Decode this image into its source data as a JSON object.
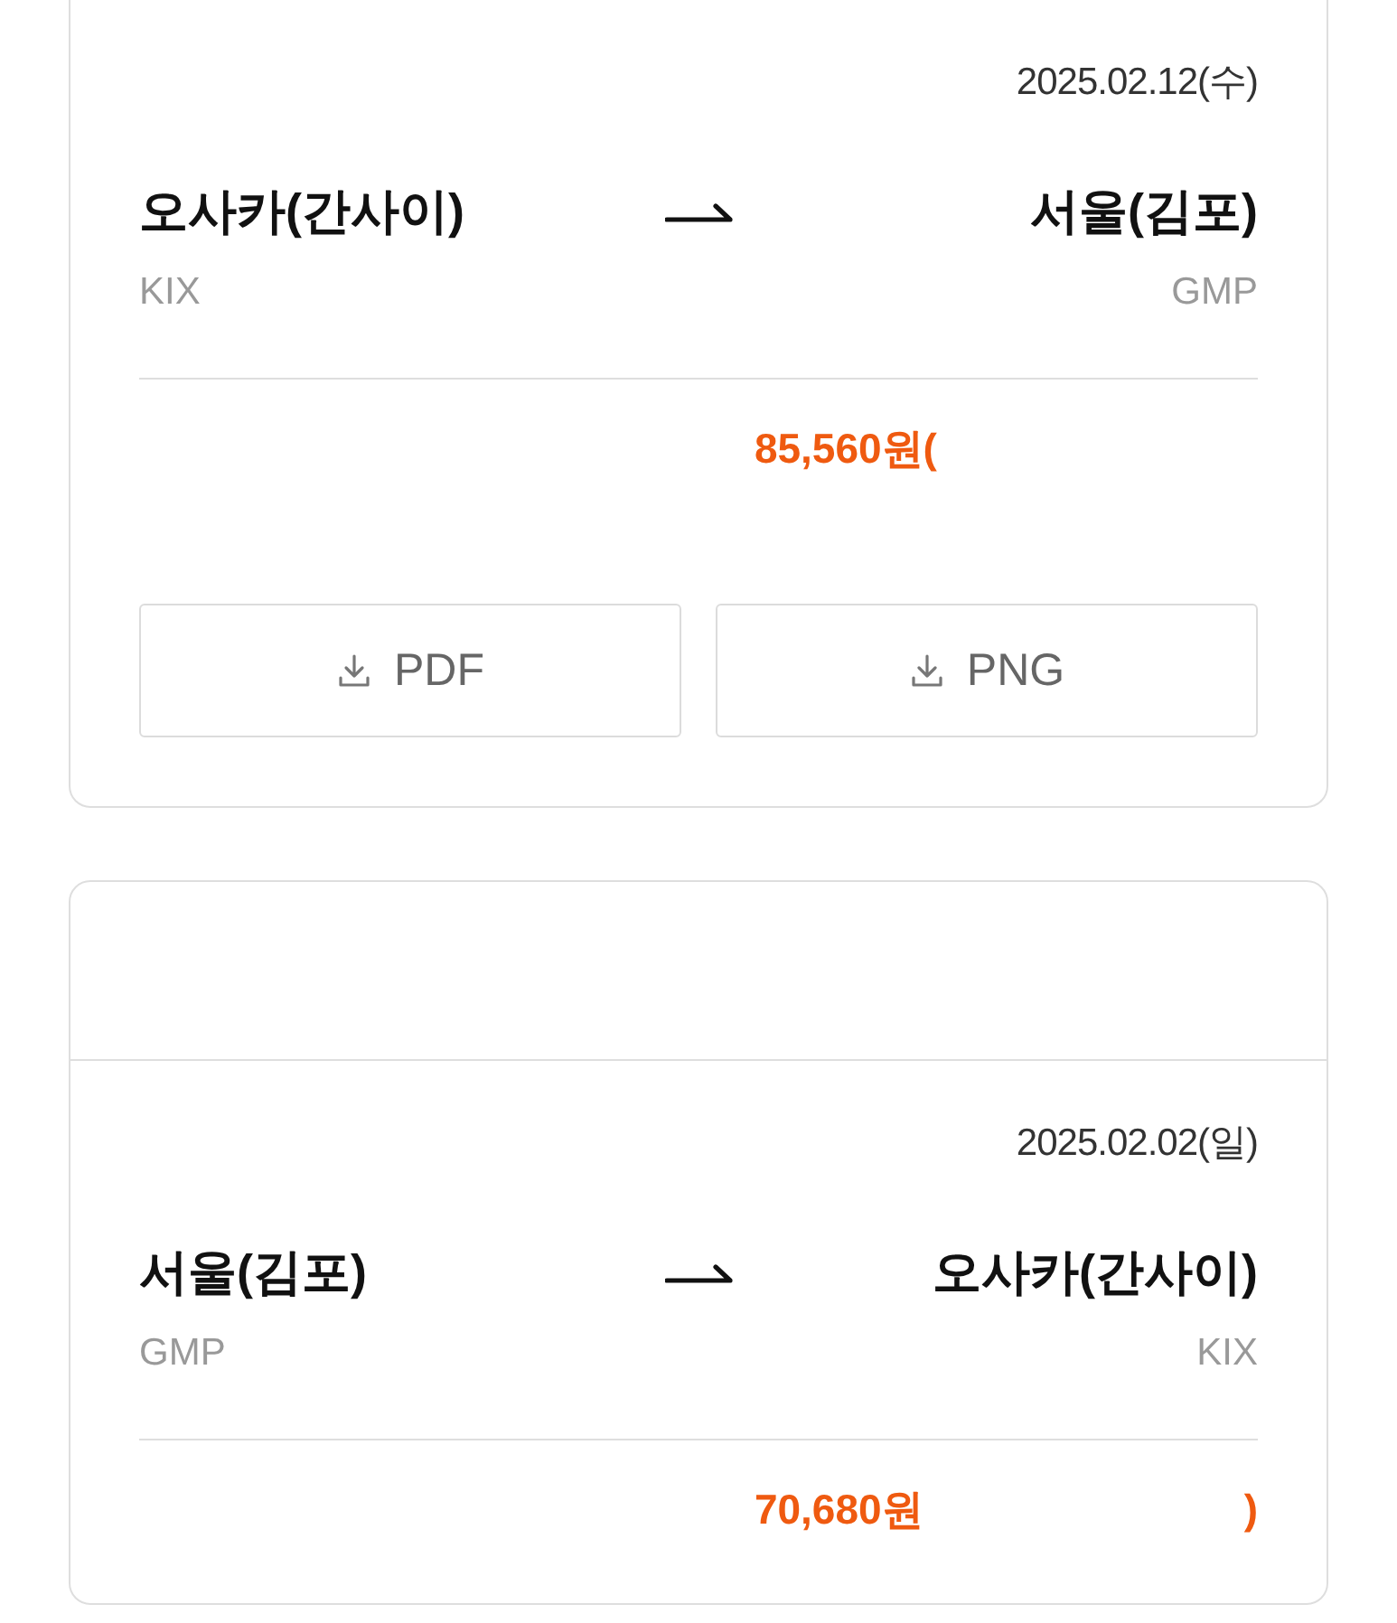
{
  "trips": [
    {
      "date": "2025.02.12(수)",
      "origin": {
        "city": "오사카(간사이)",
        "code": "KIX"
      },
      "destination": {
        "city": "서울(김포)",
        "code": "GMP"
      },
      "price": "85,560원(",
      "buttons": [
        {
          "label": "PDF",
          "kind": "download"
        },
        {
          "label": "PNG",
          "kind": "download"
        }
      ]
    },
    {
      "date": "2025.02.02(일)",
      "origin": {
        "city": "서울(김포)",
        "code": "GMP"
      },
      "destination": {
        "city": "오사카(간사이)",
        "code": "KIX"
      },
      "price": "70,680원",
      "price_tail": ")"
    }
  ]
}
